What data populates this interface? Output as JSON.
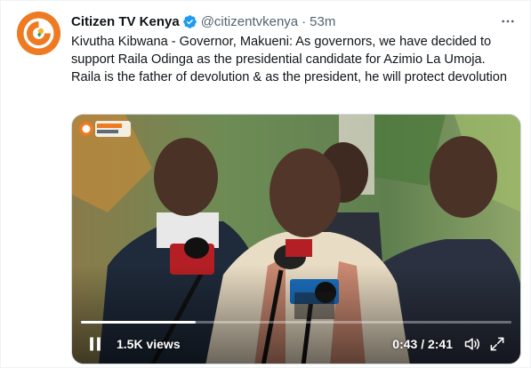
{
  "tweet": {
    "display_name": "Citizen TV Kenya",
    "handle": "@citizentvkenya",
    "separator": "·",
    "time": "53m",
    "text": "Kivutha Kibwana -  Governor, Makueni: As governors, we have decided to support Raila Odinga as the presidential candidate for Azimio La Umoja. Raila is the father of devolution & as the president, he will protect devolution"
  },
  "video": {
    "views": "1.5K views",
    "timecode": "0:43 / 2:41",
    "progress": 0.267,
    "watermark_text": "Citizen Digital"
  },
  "icons": {
    "avatar": "citizen-tv-logo",
    "verified": "verified-badge-icon",
    "more": "more-options-icon",
    "pause": "pause-icon",
    "volume": "volume-icon",
    "fullscreen": "fullscreen-icon"
  },
  "colors": {
    "brand_orange": "#ee7a22",
    "verified_blue": "#1d9bf0",
    "secondary_text": "#536471"
  }
}
